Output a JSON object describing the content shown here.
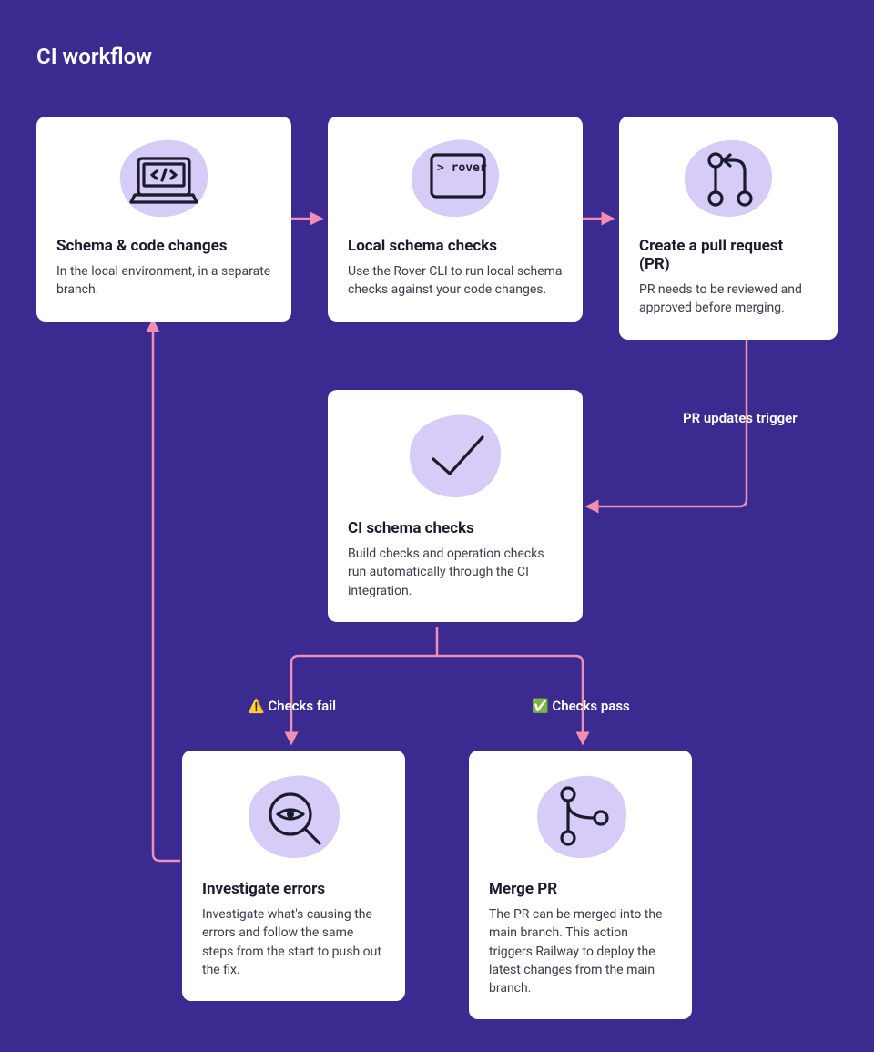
{
  "title": "CI workflow",
  "arrows": {
    "pr_trigger": "PR updates trigger",
    "fail": "Checks fail",
    "pass": "Checks pass"
  },
  "icons": {
    "fail": "⚠️",
    "pass": "✅"
  },
  "cards": {
    "schema_changes": {
      "title": "Schema & code changes",
      "desc": "In the local environment, in a separate branch."
    },
    "local_checks": {
      "title": "Local schema checks",
      "desc": "Use the Rover CLI to run local schema checks against your code changes."
    },
    "create_pr": {
      "title": "Create a pull request (PR)",
      "desc": "PR needs to be reviewed and approved before merging."
    },
    "ci_checks": {
      "title": "CI schema checks",
      "desc": "Build checks and operation checks run automatically through the CI integration."
    },
    "investigate": {
      "title": "Investigate errors",
      "desc": "Investigate what's causing the errors and follow the same steps from the start to push out the fix."
    },
    "merge": {
      "title": "Merge PR",
      "desc": "The PR can be merged into the main branch. This action triggers Railway to deploy the latest changes from the main branch."
    },
    "rover_text": "> rover"
  }
}
